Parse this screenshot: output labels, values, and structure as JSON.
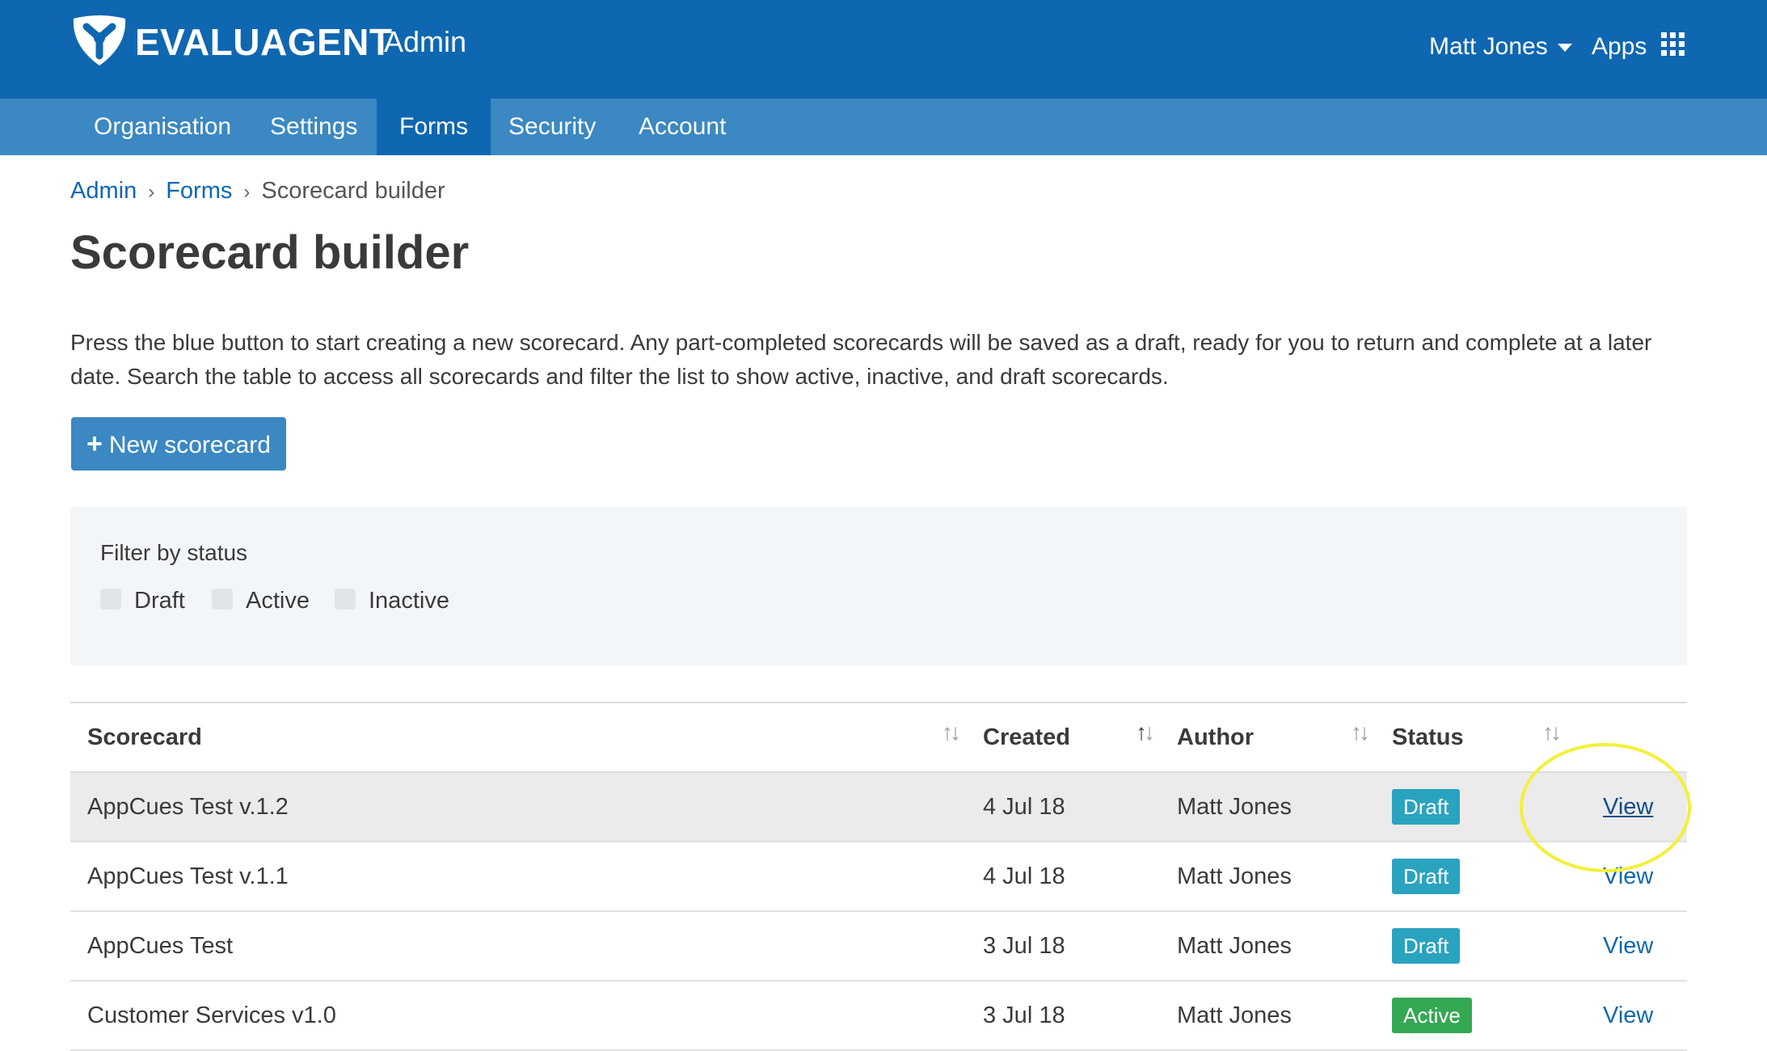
{
  "header": {
    "brand": "EVALUAGENT",
    "section": "Admin",
    "user_name": "Matt Jones",
    "apps_label": "Apps"
  },
  "nav": {
    "items": [
      {
        "label": "Organisation",
        "active": false
      },
      {
        "label": "Settings",
        "active": false
      },
      {
        "label": "Forms",
        "active": true
      },
      {
        "label": "Security",
        "active": false
      },
      {
        "label": "Account",
        "active": false
      }
    ]
  },
  "breadcrumb": {
    "items": [
      "Admin",
      "Forms",
      "Scorecard builder"
    ]
  },
  "page": {
    "title": "Scorecard builder",
    "intro": "Press the blue button to start creating a new scorecard. Any part-completed scorecards will be saved as a draft, ready for you to return and complete at a later date. Search the table to access all scorecards and filter the list to show active, inactive, and draft scorecards.",
    "new_button_label": "New scorecard"
  },
  "filter": {
    "title": "Filter by status",
    "options": [
      {
        "label": "Draft",
        "checked": false
      },
      {
        "label": "Active",
        "checked": false
      },
      {
        "label": "Inactive",
        "checked": false
      }
    ]
  },
  "table": {
    "columns": [
      "Scorecard",
      "Created",
      "Author",
      "Status"
    ],
    "rows": [
      {
        "name": "AppCues Test v.1.2",
        "created": "4 Jul 18",
        "author": "Matt Jones",
        "status": "Draft",
        "action": "View"
      },
      {
        "name": "AppCues Test v.1.1",
        "created": "4 Jul 18",
        "author": "Matt Jones",
        "status": "Draft",
        "action": "View"
      },
      {
        "name": "AppCues Test",
        "created": "3 Jul 18",
        "author": "Matt Jones",
        "status": "Draft",
        "action": "View"
      },
      {
        "name": "Customer Services v1.0",
        "created": "3 Jul 18",
        "author": "Matt Jones",
        "status": "Active",
        "action": "View"
      }
    ]
  },
  "colors": {
    "header_bg": "#0f67b1",
    "nav_bg": "#3b88c2",
    "draft_badge": "#2aa3bf",
    "active_badge": "#34a853",
    "highlight_ring": "#f3f03a"
  },
  "icons": {
    "logo": "evaluagent-logo-icon",
    "user_caret": "caret-down-icon",
    "apps": "grid-icon",
    "new": "plus-icon",
    "sort": "sort-arrows-icon"
  }
}
